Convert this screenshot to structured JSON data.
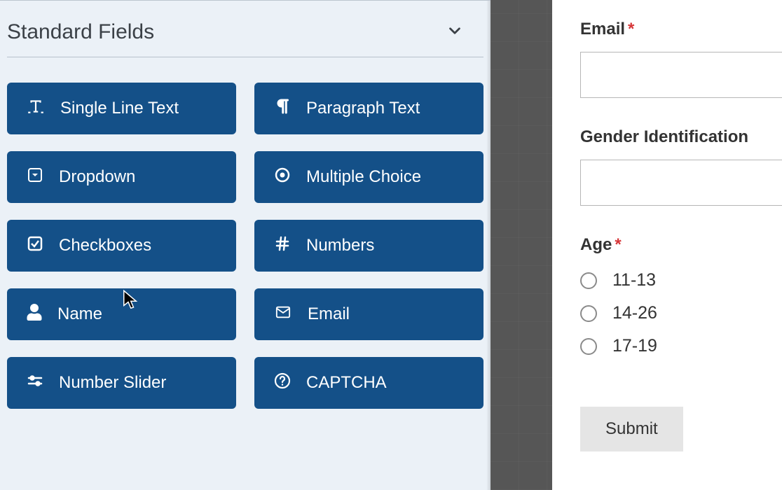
{
  "sidebar": {
    "section_title": "Standard Fields",
    "fields": [
      {
        "icon": "text-icon",
        "label": "Single Line Text"
      },
      {
        "icon": "paragraph-icon",
        "label": "Paragraph Text"
      },
      {
        "icon": "dropdown-icon",
        "label": "Dropdown"
      },
      {
        "icon": "radio-icon",
        "label": "Multiple Choice"
      },
      {
        "icon": "checkbox-icon",
        "label": "Checkboxes"
      },
      {
        "icon": "hash-icon",
        "label": "Numbers"
      },
      {
        "icon": "user-icon",
        "label": "Name"
      },
      {
        "icon": "envelope-icon",
        "label": "Email"
      },
      {
        "icon": "sliders-icon",
        "label": "Number Slider"
      },
      {
        "icon": "question-icon",
        "label": "CAPTCHA"
      }
    ]
  },
  "form": {
    "email_label": "Email",
    "gender_label": "Gender Identification",
    "age_label": "Age",
    "age_options": [
      "11-13",
      "14-26",
      "17-19"
    ],
    "submit_label": "Submit"
  }
}
